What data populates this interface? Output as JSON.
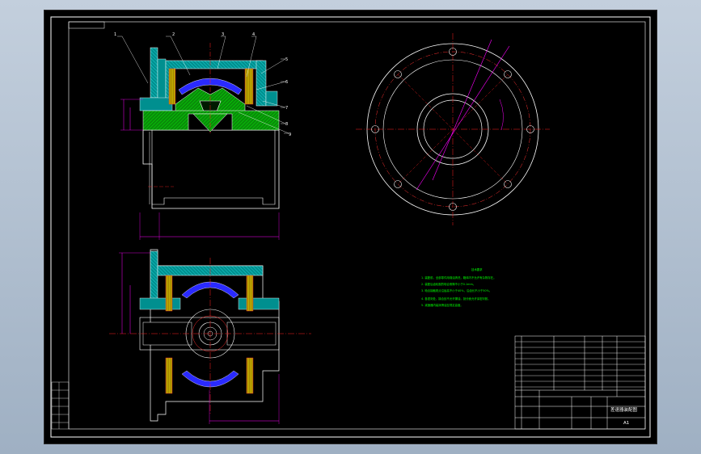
{
  "drawing": {
    "sheet_size": "A1",
    "title": "差速器装配图",
    "notes_title": "技术要求",
    "notes": [
      "1. 装配前，全部零件用煤油清洗，箱体内不允许有杂物存在。",
      "2. 装配后齿轮副的啮合侧隙不小于0.1mm。",
      "3. 啮合接触斑点沿齿高不小于40%，沿齿长不小于50%。",
      "4. 各密封处、接合处不允许漏油，剖分面允许涂密封胶。",
      "5. 减速器内装润滑油至规定高度。"
    ],
    "part_labels": [
      "1",
      "2",
      "3",
      "4",
      "5",
      "6",
      "7",
      "8",
      "9"
    ]
  },
  "colors": {
    "background": "#000000",
    "outline": "#ffffff",
    "dimension": "#ff00ff",
    "centerline": "#ff2020",
    "housing": "#00bfbf",
    "gear": "#00c800",
    "bearing": "#ffff00",
    "insert": "#2a2aff",
    "notes": "#00ff00"
  }
}
